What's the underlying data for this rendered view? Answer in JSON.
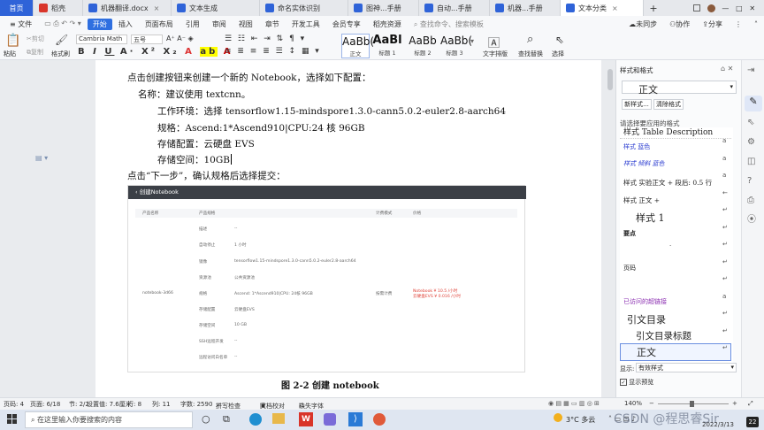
{
  "tabs": [
    {
      "label": "首页",
      "kind": "home"
    },
    {
      "label": "稻壳",
      "color": "#d9352a"
    },
    {
      "label": "机器翻译.docx",
      "color": "#2f63d8"
    },
    {
      "label": "文本生成",
      "color": "#2f63d8"
    },
    {
      "label": "命名实体识别",
      "color": "#2f63d8"
    },
    {
      "label": "图神...手册",
      "color": "#2f63d8"
    },
    {
      "label": "自动...手册",
      "color": "#2f63d8"
    },
    {
      "label": "机器...手册",
      "color": "#2f63d8"
    },
    {
      "label": "文本分类",
      "color": "#2f63d8",
      "active": true
    }
  ],
  "menu": {
    "file": "≡ 文件",
    "items": [
      "开始",
      "插入",
      "页面布局",
      "引用",
      "审阅",
      "视图",
      "章节",
      "开发工具",
      "会员专享",
      "稻壳资源"
    ],
    "search": "查找命令、搜索模板",
    "right": [
      "未同步",
      "协作",
      "分享"
    ]
  },
  "ribbon": {
    "paste": "粘贴",
    "cut": "剪切",
    "copy": "复制",
    "format_painter": "格式刷",
    "font": "Cambria Math",
    "size": "五号",
    "styles": [
      {
        "big": "AaBb(",
        "lbl": "正文"
      },
      {
        "big": "AaBl",
        "lbl": "标题 1"
      },
      {
        "big": "AaBb",
        "lbl": "标题 2"
      },
      {
        "big": "AaBb(",
        "lbl": "标题 3"
      }
    ],
    "text_layout": "文字排版",
    "find_replace": "查找替换",
    "select": "选择"
  },
  "doc": {
    "intro": "点击创建按钮来创建一个新的 Notebook，选择如下配置：",
    "name": "名称：建议使用 textcnn。",
    "env": "工作环境：选择 tensorflow1.15-mindspore1.3.0-cann5.0.2-euler2.8-aarch64",
    "spec": "规格：Ascend:1*Ascend910|CPU:24 核 96GB",
    "storage": "存储配置：云硬盘 EVS",
    "space": "存储空间：10GB",
    "next": "点击“下一步”，确认规格后选择提交：",
    "caption": "图 2-2  创建 notebook"
  },
  "shot": {
    "title": "创建Notebook",
    "cols": [
      "产品名称",
      "产品规格",
      "计费模式",
      "价格"
    ],
    "product": "notebook-3d66",
    "rows": [
      {
        "k": "描述",
        "v": "--"
      },
      {
        "k": "自动停止",
        "v": "1 小时"
      },
      {
        "k": "镜像",
        "v": "tensorflow1.15-mindspore1.3.0-cann5.0.2-euler2.8-aarch64"
      },
      {
        "k": "资源池",
        "v": "公共资源池"
      },
      {
        "k": "规格",
        "v": "Ascend: 1*Ascend910|CPU: 24核 96GB"
      },
      {
        "k": "存储配置",
        "v": "云硬盘EVS"
      },
      {
        "k": "存储空间",
        "v": "10 GB"
      },
      {
        "k": "SSH远程开发",
        "v": "--"
      },
      {
        "k": "远程访问白名单",
        "v": "--"
      }
    ],
    "billing": "按需计费",
    "price1": "Notebook ¥ 10.5 /小时",
    "price2": "云硬盘EVS ¥ 0.016 /小时"
  },
  "pane": {
    "title": "样式和格式",
    "current": "正文",
    "new_style": "新样式...",
    "clear": "清除格式",
    "prompt": "请选择要应用的格式",
    "items": [
      {
        "t": "样式  Table Description"
      },
      {
        "t": "样式  蓝色"
      },
      {
        "t": "样式  倾斜  蓝色"
      },
      {
        "t": "样式  实验正文 + 段后: 0.5  行"
      },
      {
        "t": "样式  正文 +"
      },
      {
        "t": "样式 1"
      },
      {
        "t": "要点"
      },
      {
        "t": "."
      },
      {
        "t": "页码"
      },
      {
        "t": "已访问的超链接"
      },
      {
        "t": "引文目录"
      },
      {
        "t": "引文目录标题"
      },
      {
        "t": "正文"
      }
    ],
    "show_label": "显示:",
    "show_value": "有效样式",
    "preview": "显示预览"
  },
  "status": {
    "page": "页码: 4",
    "pages": "页面: 6/18",
    "section": "节: 2/2",
    "setting": "设置值: 7.6厘米",
    "row": "行: 8",
    "col": "列: 11",
    "words": "字数: 2590",
    "spell": "拼写检查",
    "proof": "文档校对",
    "missing_font": "缺失字体",
    "zoom": "140%"
  },
  "taskbar": {
    "search": "在这里输入你要搜索的内容",
    "weather": "3°C 多云",
    "date": "2022/3/13",
    "badge": "22",
    "watermark": "CSDN @程思睿Sir"
  }
}
